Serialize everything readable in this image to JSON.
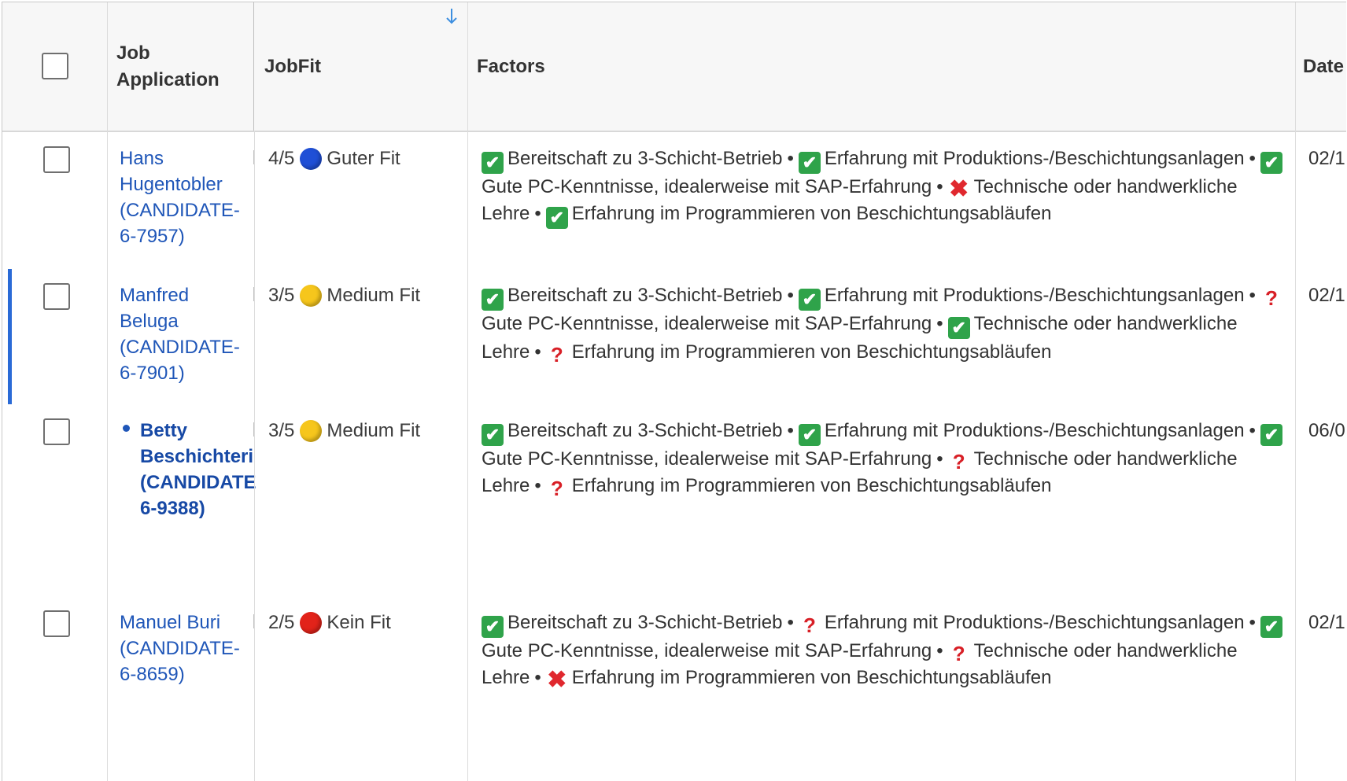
{
  "header": {
    "job_application": "Job Application",
    "job_application_line1": "Job",
    "job_application_line2": "Application",
    "jobfit": "JobFit",
    "factors": "Factors",
    "date": "Date"
  },
  "rows": [
    {
      "name_lines": [
        "Hans",
        "Hugentobler",
        "(CANDIDATE-",
        "6-7957)"
      ],
      "score": "4/5",
      "fit_label": "Guter Fit",
      "fit_color": "#1f4fd6",
      "date": "02/1",
      "unread": false,
      "selected": false,
      "factors": [
        {
          "status": "ok",
          "text": "Bereitschaft zu 3-Schicht-Betrieb"
        },
        {
          "status": "ok",
          "text": "Erfahrung mit Produktions-/Beschichtungsanlagen"
        },
        {
          "status": "ok",
          "text": "Gute PC-Kenntnisse, idealerweise mit SAP-Erfahrung"
        },
        {
          "status": "no",
          "text": "Technische oder handwerkliche Lehre"
        },
        {
          "status": "ok",
          "text": "Erfahrung im Programmieren von Beschichtungsabläufen"
        }
      ]
    },
    {
      "name_lines": [
        "Manfred",
        "Beluga",
        "(CANDIDATE-",
        "6-7901)"
      ],
      "score": "3/5",
      "fit_label": "Medium Fit",
      "fit_color": "#f6c61c",
      "date": "02/1",
      "unread": false,
      "selected": true,
      "factors": [
        {
          "status": "ok",
          "text": "Bereitschaft zu 3-Schicht-Betrieb"
        },
        {
          "status": "ok",
          "text": "Erfahrung mit Produktions-/Beschichtungsanlagen"
        },
        {
          "status": "q",
          "text": "Gute PC-Kenntnisse, idealerweise mit SAP-Erfahrung"
        },
        {
          "status": "ok",
          "text": "Technische oder handwerkliche Lehre"
        },
        {
          "status": "q",
          "text": "Erfahrung im Programmieren von Beschichtungsabläufen"
        }
      ]
    },
    {
      "name_lines": [
        "Betty",
        "Beschichteri",
        "(CANDIDATE",
        "6-9388)"
      ],
      "score": "3/5",
      "fit_label": "Medium Fit",
      "fit_color": "#f6c61c",
      "date": "06/0",
      "unread": true,
      "selected": false,
      "factors": [
        {
          "status": "ok",
          "text": "Bereitschaft zu 3-Schicht-Betrieb"
        },
        {
          "status": "ok",
          "text": "Erfahrung mit Produktions-/Beschichtungsanlagen"
        },
        {
          "status": "ok",
          "text": "Gute PC-Kenntnisse, idealerweise mit SAP-Erfahrung"
        },
        {
          "status": "q",
          "text": "Technische oder handwerkliche Lehre"
        },
        {
          "status": "q",
          "text": "Erfahrung im Programmieren von Beschichtungsabläufen"
        }
      ]
    },
    {
      "name_lines": [
        "Manuel Buri",
        "(CANDIDATE-",
        "6-8659)"
      ],
      "score": "2/5",
      "fit_label": "Kein Fit",
      "fit_color": "#e2231a",
      "date": "02/1",
      "unread": false,
      "selected": false,
      "factors": [
        {
          "status": "ok",
          "text": "Bereitschaft zu 3-Schicht-Betrieb"
        },
        {
          "status": "q",
          "text": "Erfahrung mit Produktions-/Beschichtungsanlagen"
        },
        {
          "status": "ok",
          "text": "Gute PC-Kenntnisse, idealerweise mit SAP-Erfahrung"
        },
        {
          "status": "q",
          "text": "Technische oder handwerkliche Lehre"
        },
        {
          "status": "no",
          "text": "Erfahrung im Programmieren von Beschichtungsabläufen"
        }
      ]
    }
  ],
  "icons": {
    "sort": "arrow-down-icon",
    "ok": "check-mark-icon",
    "no": "cross-mark-icon",
    "q": "question-mark-icon"
  }
}
